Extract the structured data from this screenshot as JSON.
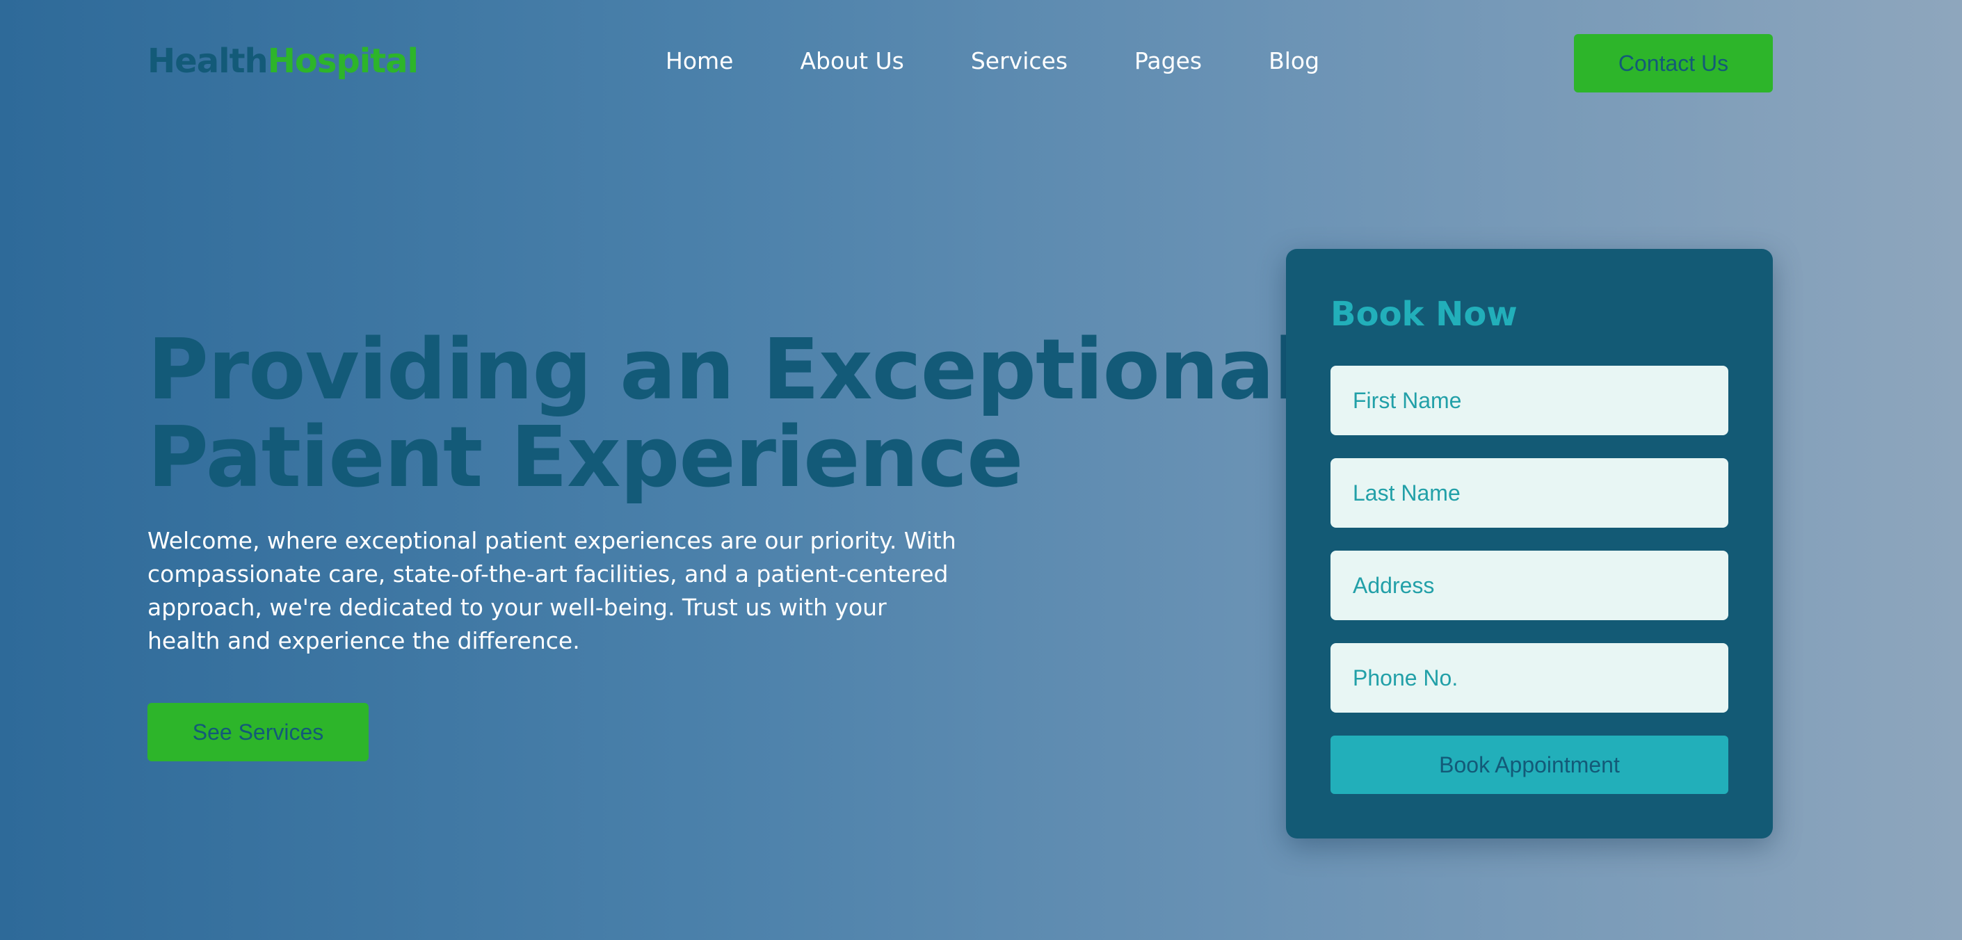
{
  "brand": {
    "part1": "Health",
    "part2": "Hospital"
  },
  "nav": {
    "items": [
      "Home",
      "About Us",
      "Services",
      "Pages",
      "Blog"
    ]
  },
  "header": {
    "contact_label": "Contact Us"
  },
  "hero": {
    "title_line1": "Providing an Exceptional",
    "title_line2": "Patient Experience",
    "description": "Welcome, where exceptional patient experiences are our priority. With compassionate care, state-of-the-art facilities, and a patient-centered approach, we're dedicated to your well-being. Trust us with your health and experience the difference.",
    "cta_label": "See Services"
  },
  "booking": {
    "title": "Book Now",
    "fields": {
      "first_name_placeholder": "First Name",
      "last_name_placeholder": "Last Name",
      "address_placeholder": "Address",
      "phone_placeholder": "Phone No."
    },
    "submit_label": "Book Appointment"
  },
  "colors": {
    "brand_dark": "#135a78",
    "brand_green": "#2db52a",
    "accent_teal": "#22afba",
    "card_bg": "#135a75",
    "input_bg": "#e8f6f4"
  }
}
